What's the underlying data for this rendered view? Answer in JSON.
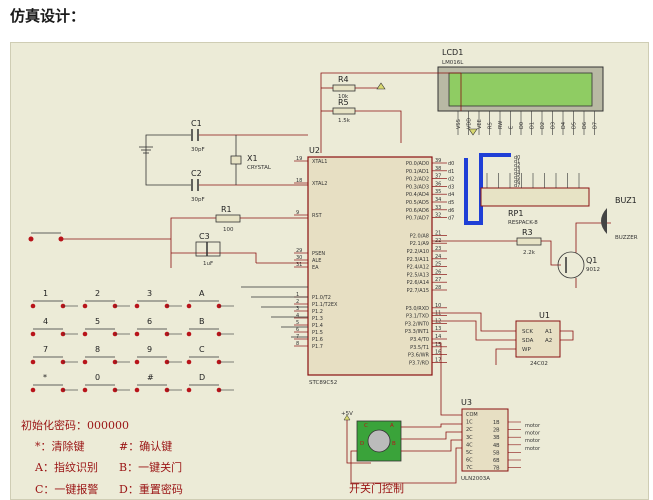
{
  "page": {
    "heading": "仿真设计："
  },
  "schematic": {
    "lcd": {
      "ref": "LCD1",
      "part": "LM016L",
      "pins": [
        "VSS",
        "VDD",
        "VEE",
        "RS",
        "RW",
        "E",
        "D0",
        "D1",
        "D2",
        "D3",
        "D4",
        "D5",
        "D6",
        "D7"
      ]
    },
    "mcu": {
      "ref": "U2",
      "part": "STC89C52",
      "left_pins": [
        "XTAL1",
        "XTAL2",
        "RST",
        "PSEN",
        "ALE",
        "EA",
        "P1.0/T2",
        "P1.1/T2EX",
        "P1.2",
        "P1.3",
        "P1.4",
        "P1.5",
        "P1.6",
        "P1.7"
      ],
      "left_nums": [
        "19",
        "18",
        "9",
        "29",
        "30",
        "31",
        "1",
        "2",
        "3",
        "4",
        "5",
        "6",
        "7",
        "8"
      ],
      "right_pins": [
        "P0.0/AD0",
        "P0.1/AD1",
        "P0.2/AD2",
        "P0.3/AD3",
        "P0.4/AD4",
        "P0.5/AD5",
        "P0.6/AD6",
        "P0.7/AD7",
        "P2.0/A8",
        "P2.1/A9",
        "P2.2/A10",
        "P2.3/A11",
        "P2.4/A12",
        "P2.5/A13",
        "P2.6/A14",
        "P2.7/A15",
        "P3.0/RXD",
        "P3.1/TXD",
        "P3.2/INT0",
        "P3.3/INT1",
        "P3.4/T0",
        "P3.5/T1",
        "P3.6/WR",
        "P3.7/RD"
      ],
      "right_nums": [
        "39",
        "38",
        "37",
        "36",
        "35",
        "34",
        "33",
        "32",
        "21",
        "22",
        "23",
        "24",
        "25",
        "26",
        "27",
        "28",
        "10",
        "11",
        "12",
        "13",
        "14",
        "15",
        "16",
        "17"
      ]
    },
    "crystal": {
      "ref": "X1",
      "part": "CRYSTAL"
    },
    "c1": {
      "ref": "C1",
      "value": "30pF"
    },
    "c2": {
      "ref": "C2",
      "value": "30pF"
    },
    "c3": {
      "ref": "C3",
      "value": "1uF"
    },
    "r1": {
      "ref": "R1",
      "value": "100"
    },
    "r3": {
      "ref": "R3",
      "value": "2.2k"
    },
    "r4": {
      "ref": "R4",
      "value": "10k"
    },
    "r5": {
      "ref": "R5",
      "value": "1.5k"
    },
    "rp1": {
      "ref": "RP1",
      "part": "RESPACK-8"
    },
    "q1": {
      "ref": "Q1",
      "part": "9012"
    },
    "buzzer": {
      "ref": "BUZ1",
      "part": "BUZZER"
    },
    "u1": {
      "ref": "U1",
      "part": "24C02",
      "pins_left": [
        "SCK",
        "SDA",
        "WP"
      ],
      "pins_right": [
        "A1",
        "A2"
      ]
    },
    "u3": {
      "ref": "U3",
      "part": "ULN2003A",
      "pins_left": [
        "COM",
        "1C",
        "2C",
        "3C",
        "4C",
        "5C",
        "6C",
        "7C"
      ],
      "pins_right": [
        "1B",
        "2B",
        "3B",
        "4B",
        "5B",
        "6B",
        "7B"
      ]
    },
    "v5": "+5V",
    "bus": [
      "d0",
      "d1",
      "d2",
      "d3",
      "d4",
      "d5",
      "d6",
      "d7"
    ],
    "motor_nets": [
      "motor",
      "motor",
      "motor",
      "motor"
    ],
    "keys": [
      "1",
      "2",
      "3",
      "A",
      "4",
      "5",
      "6",
      "B",
      "7",
      "8",
      "9",
      "C",
      "*",
      "0",
      "#",
      "D"
    ]
  },
  "notes": {
    "init_pwd": "初始化密码：000000",
    "star": "*：清除键",
    "hash": "#：确认键",
    "a": "A：指纹识别",
    "b": "B：一键关门",
    "c": "C：一键报警",
    "d": "D：重置密码",
    "door": "开关门控制"
  }
}
